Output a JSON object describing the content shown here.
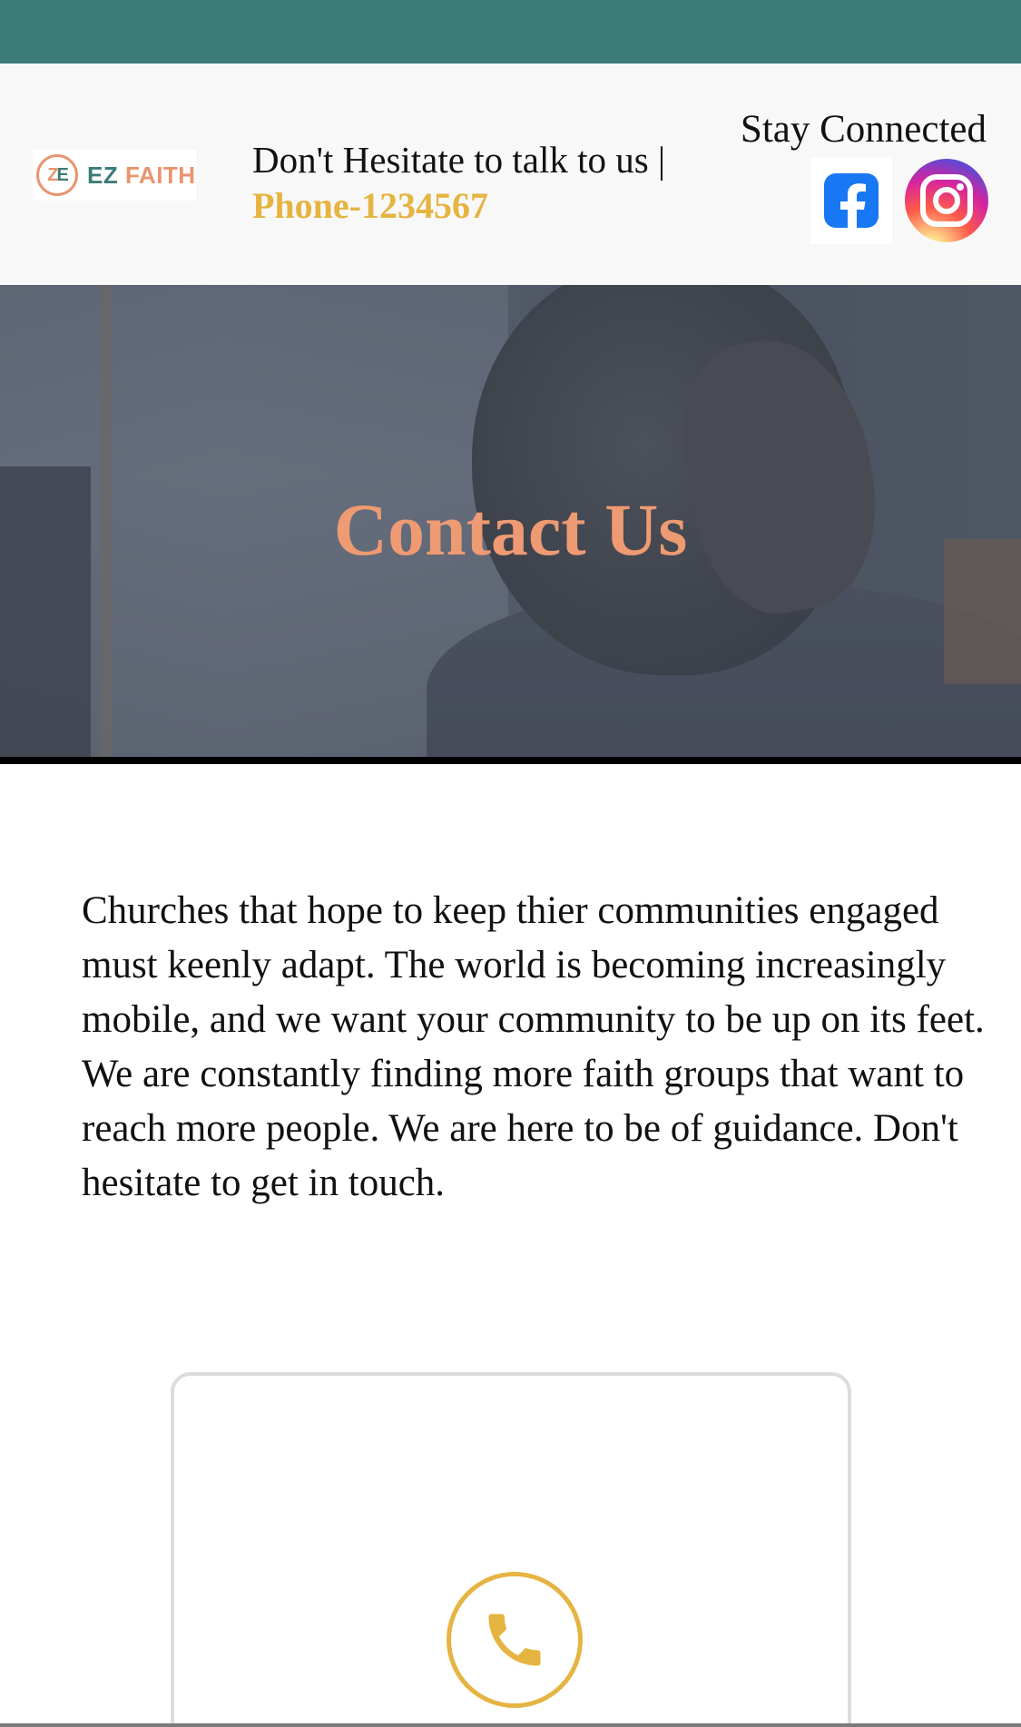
{
  "header": {
    "logo_text_ez": "EZ",
    "logo_text_faith": "FAITH",
    "logo_mark_z": "Z",
    "logo_mark_e": "E",
    "hesitate_text": "Don't Hesitate to talk to us |",
    "phone_text": "Phone-1234567",
    "stay_connected": "Stay Connected"
  },
  "social": {
    "facebook_icon": "facebook-icon",
    "instagram_icon": "instagram-icon"
  },
  "hero": {
    "title": "Contact Us"
  },
  "intro": {
    "text": "Churches that hope to keep thier communities engaged must keenly adapt. The world is becoming increasingly mobile, and we want your community to be up on its feet. We are constantly finding more faith groups that want to reach more people. We are here to be of guidance. Don't hesitate to get in touch."
  },
  "card": {
    "icon": "phone-icon"
  },
  "colors": {
    "top_bar": "#3b7c79",
    "accent_gold": "#e5b441",
    "accent_salmon": "#ee9a72",
    "facebook_blue": "#1877f2"
  }
}
